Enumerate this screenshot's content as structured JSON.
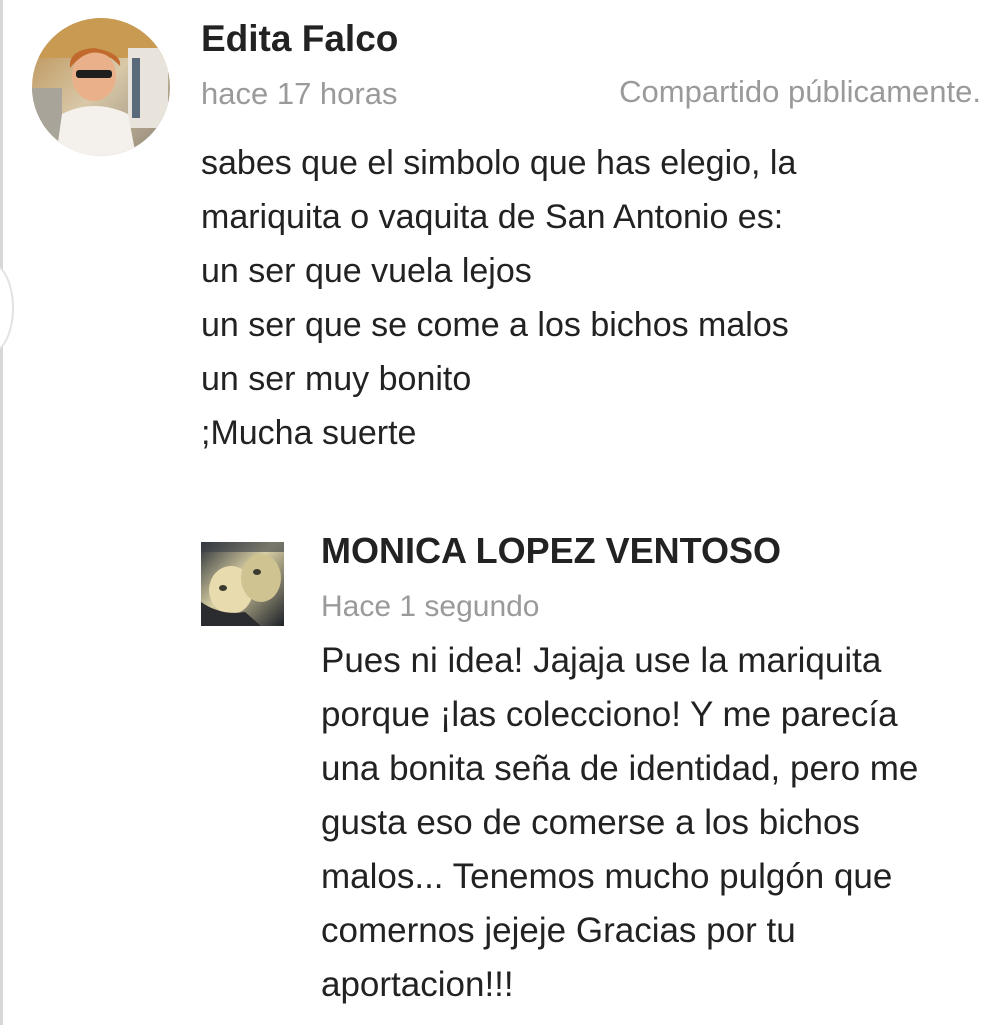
{
  "comment": {
    "author": "Edita Falco",
    "time": "hace 17 horas",
    "visibility": "Compartido públicamente.",
    "body_lines": [
      "sabes que el simbolo que has elegio, la",
      "mariquita o vaquita de San Antonio es:",
      "un ser que vuela lejos",
      "un ser que se come a los bichos malos",
      "un ser muy bonito",
      ";Mucha suerte"
    ]
  },
  "reply": {
    "author": "MONICA LOPEZ VENTOSO",
    "time": "Hace 1 segundo",
    "body_lines": [
      "Pues ni idea! Jajaja use la mariquita",
      "porque ¡las colecciono! Y me parecía",
      "una bonita seña de identidad, pero me",
      "gusta eso de comerse a los bichos",
      "malos... Tenemos mucho pulgón que",
      "comernos jejeje Gracias por tu",
      "aportacion!!!"
    ]
  },
  "colors": {
    "text": "#222222",
    "muted": "#9a9a9a",
    "rail": "#d7d7d7",
    "background": "#ffffff"
  },
  "icons": [
    "avatar-edita-falco",
    "avatar-monica-lopez-ventoso"
  ]
}
